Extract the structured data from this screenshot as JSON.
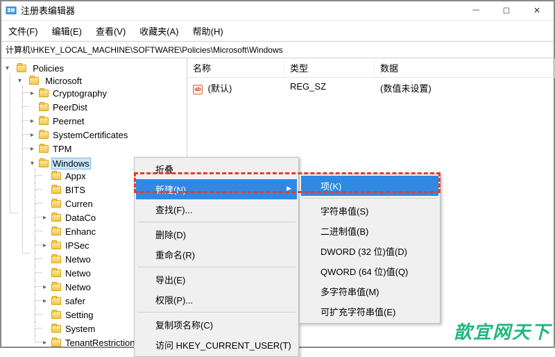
{
  "window": {
    "title": "注册表编辑器",
    "menu": [
      "文件(F)",
      "编辑(E)",
      "查看(V)",
      "收藏夹(A)",
      "帮助(H)"
    ],
    "address": "计算机\\HKEY_LOCAL_MACHINE\\SOFTWARE\\Policies\\Microsoft\\Windows"
  },
  "tree": {
    "root": {
      "label": "Policies",
      "expander": "open"
    },
    "microsoft": {
      "label": "Microsoft",
      "expander": "open"
    },
    "children": [
      {
        "label": "Cryptography",
        "expander": "closed"
      },
      {
        "label": "PeerDist",
        "expander": "none"
      },
      {
        "label": "Peernet",
        "expander": "closed"
      },
      {
        "label": "SystemCertificates",
        "expander": "closed"
      },
      {
        "label": "TPM",
        "expander": "closed"
      },
      {
        "label": "Windows",
        "expander": "open",
        "selected": true
      }
    ],
    "windows_children": [
      {
        "label": "Appx",
        "expander": "none"
      },
      {
        "label": "BITS",
        "expander": "none"
      },
      {
        "label": "Curren",
        "expander": "none"
      },
      {
        "label": "DataCo",
        "expander": "closed"
      },
      {
        "label": "Enhanc",
        "expander": "none"
      },
      {
        "label": "IPSec",
        "expander": "closed"
      },
      {
        "label": "Netwo",
        "expander": "none"
      },
      {
        "label": "Netwo",
        "expander": "none"
      },
      {
        "label": "Netwo",
        "expander": "closed"
      },
      {
        "label": "safer",
        "expander": "closed"
      },
      {
        "label": "Setting",
        "expander": "none"
      },
      {
        "label": "System",
        "expander": "none"
      },
      {
        "label": "TenantRestriction",
        "expander": "closed"
      }
    ]
  },
  "list": {
    "columns": {
      "name": "名称",
      "type": "类型",
      "data": "数据"
    },
    "row": {
      "name": "(默认)",
      "type": "REG_SZ",
      "data": "(数值未设置)",
      "icon": "ab"
    }
  },
  "ctx1": {
    "collapse": "折叠",
    "new": "新建(N)",
    "find": "查找(F)...",
    "delete": "删除(D)",
    "rename": "重命名(R)",
    "export": "导出(E)",
    "perm": "权限(P)...",
    "copykey": "复制项名称(C)",
    "gohkcu": "访问 HKEY_CURRENT_USER(T)"
  },
  "ctx2": {
    "key": "项(K)",
    "string": "字符串值(S)",
    "binary": "二进制值(B)",
    "dword": "DWORD (32 位)值(D)",
    "qword": "QWORD (64 位)值(Q)",
    "multi": "多字符串值(M)",
    "expand": "可扩充字符串值(E)"
  },
  "watermark": "歆宜网天下"
}
